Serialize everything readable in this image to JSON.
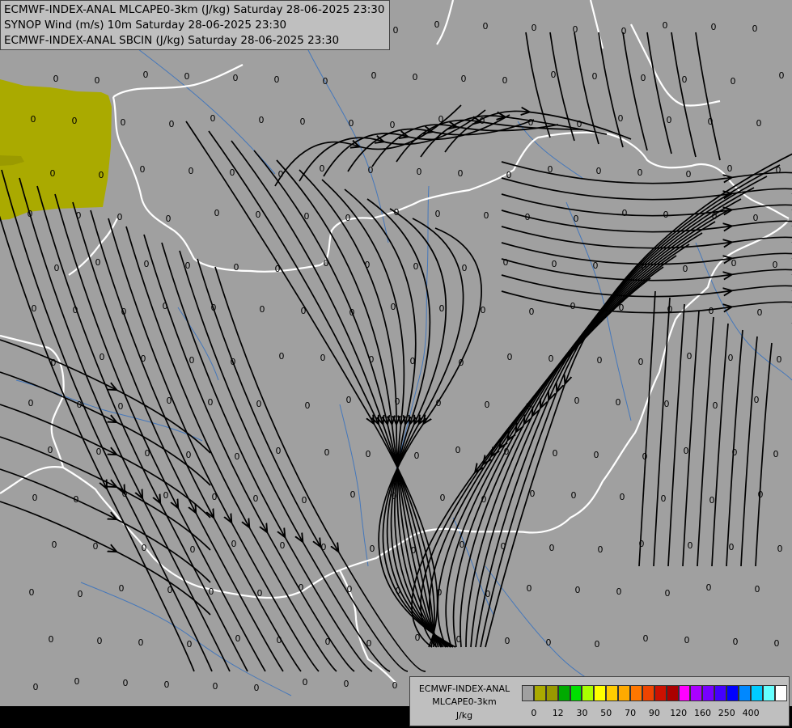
{
  "title_lines": [
    "ECMWF-INDEX-ANAL MLCAPE0-3km (J/kg) Saturday 28-06-2025 23:30",
    "SYNOP Wind (m/s) 10m Saturday 28-06-2025 23:30",
    "ECMWF-INDEX-ANAL SBCIN (J/kg) Saturday 28-06-2025 23:30"
  ],
  "legend": {
    "line1": "ECMWF-INDEX-ANAL",
    "line2": "MLCAPE0-3km",
    "units": "J/kg",
    "tick_labels": [
      "0",
      "12",
      "30",
      "50",
      "70",
      "90",
      "120",
      "160",
      "250",
      "400"
    ],
    "colors": [
      "#a0a0a0",
      "#aaaa00",
      "#999900",
      "#00aa00",
      "#00e000",
      "#aaff00",
      "#ffff00",
      "#ffcc00",
      "#ffaa00",
      "#ff7700",
      "#ee4400",
      "#cc1100",
      "#aa0000",
      "#ff00ff",
      "#aa00ff",
      "#7700ff",
      "#4400ff",
      "#0000ff",
      "#0088ff",
      "#00ccff",
      "#66ffff",
      "#ffffff"
    ]
  },
  "map_colors": {
    "background": "#a0a0a0",
    "cape_area": "#aaaa00",
    "border": "#ffffff",
    "river": "#4477bb",
    "streamline": "#000000"
  },
  "sbcin_value_label": "0"
}
